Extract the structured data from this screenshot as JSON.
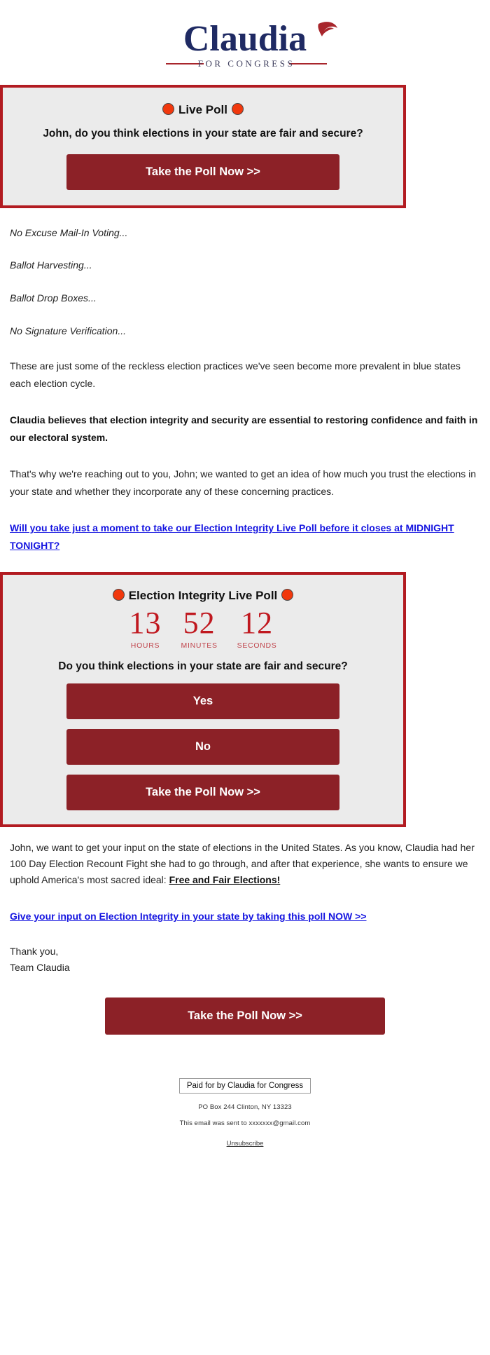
{
  "brand": {
    "name": "Claudia",
    "tagline": "FOR CONGRESS",
    "navy": "#1f2a63",
    "red": "#a8262c",
    "button_red": "#8c2127",
    "border_red": "#b21b21",
    "dot_red": "#f1380d",
    "link_blue": "#1414e0"
  },
  "poll_top": {
    "badge_label": "Live Poll",
    "dot_icon": "red-circle",
    "question": "John, do you think elections in your state are fair and secure?",
    "cta_label": "Take the Poll Now >>"
  },
  "italics": [
    "No Excuse Mail-In Voting...",
    "Ballot Harvesting...",
    "Ballot Drop Boxes...",
    "No Signature Verification..."
  ],
  "body": {
    "p1": "These are just some of the reckless election practices we've seen become more prevalent in blue states each election cycle.",
    "p2_bold": "Claudia believes that election integrity and security are essential to restoring confidence and faith in our electoral system.",
    "p3": "That's why we're reaching out to you, John; we wanted to get an idea of how much you trust the elections in your state and whether they incorporate any of these concerning practices.",
    "link1": "Will you take just a moment to take our Election Integrity Live Poll before it closes at MIDNIGHT TONIGHT?"
  },
  "poll_bottom": {
    "badge_label": "Election Integrity Live Poll",
    "dot_icon": "red-circle",
    "countdown": [
      {
        "value": "13",
        "label": "HOURS"
      },
      {
        "value": "52",
        "label": "MINUTES"
      },
      {
        "value": "12",
        "label": "SECONDS"
      }
    ],
    "question": "Do you think elections in your state are fair and secure?",
    "yes_label": "Yes",
    "no_label": "No",
    "cta_label": "Take the Poll Now >>"
  },
  "closing": {
    "p1_part1": "John, we want to get your input on the state of elections in the United States. As you know, Claudia had her 100 Day Election Recount Fight she had to go through, and after that experience, she wants to ensure we uphold America's most sacred ideal: ",
    "p1_emph": "Free and Fair Elections!",
    "link2": "Give your input on Election Integrity in your state by taking this poll NOW >>",
    "sign_off_1": "Thank you,",
    "sign_off_2": "Team Claudia",
    "cta_label": "Take the Poll Now >>"
  },
  "footer": {
    "paid_for": "Paid for by Claudia for Congress",
    "address": "PO Box 244 Clinton, NY 13323",
    "sent_to": "This email was sent to xxxxxxx@gmail.com",
    "unsubscribe": "Unsubscribe"
  }
}
